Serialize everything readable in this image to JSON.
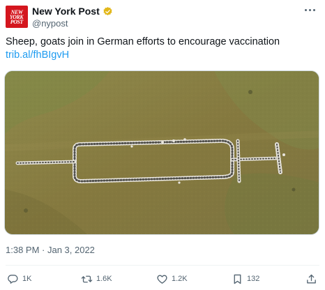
{
  "author": {
    "display_name": "New York Post",
    "handle": "@nypost",
    "logo_lines": [
      "NEW",
      "YORK",
      "POST"
    ],
    "verified_color": "#e2b719"
  },
  "tweet": {
    "text": "Sheep, goats join in German efforts to encourage vaccination",
    "link": "trib.al/fhBIgvH",
    "timestamp": "1:38 PM · Jan 3, 2022"
  },
  "actions": {
    "replies": "1K",
    "retweets": "1.6K",
    "likes": "1.2K",
    "bookmarks": "132"
  },
  "colors": {
    "link": "#1d9bf0",
    "secondary_text": "#536471",
    "brand_red": "#d4161e"
  },
  "icons": [
    "more-icon",
    "verified-badge-icon",
    "reply-icon",
    "retweet-icon",
    "like-icon",
    "bookmark-icon",
    "share-icon"
  ]
}
